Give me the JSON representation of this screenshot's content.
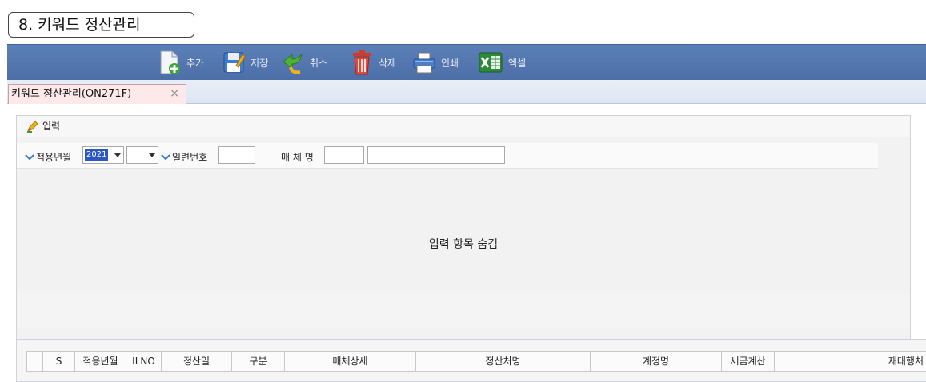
{
  "section": {
    "title": "8. 키워드 정산관리"
  },
  "toolbar": {
    "buttons": [
      {
        "id": "add",
        "label": "추가",
        "icon": "add-document-icon"
      },
      {
        "id": "save",
        "label": "저장",
        "icon": "save-disk-icon"
      },
      {
        "id": "cancel",
        "label": "취소",
        "icon": "undo-arrow-icon"
      },
      {
        "id": "delete",
        "label": "삭제",
        "icon": "trash-icon"
      },
      {
        "id": "print",
        "label": "인쇄",
        "icon": "printer-icon"
      },
      {
        "id": "excel",
        "label": "엑셀",
        "icon": "excel-icon"
      }
    ],
    "colors": {
      "bar": "#5476b0"
    }
  },
  "tabs": [
    {
      "label": "키워드 정산관리(ON271F)",
      "close": "×"
    }
  ],
  "panel": {
    "header": "입력",
    "filters": {
      "apply_month_label": "적용년월",
      "year_value": "2021",
      "month_value": "",
      "serial_label": "일련번호",
      "serial_value": "",
      "media_label": "매 체 명",
      "media_code": "",
      "media_name": ""
    },
    "hidden_message": "입력 항목 숨김"
  },
  "grid": {
    "columns": [
      "",
      "S",
      "적용년월",
      "ILNO",
      "정산일",
      "구분",
      "매체상세",
      "정산처명",
      "계정명",
      "세금계산",
      "재대행처"
    ]
  }
}
